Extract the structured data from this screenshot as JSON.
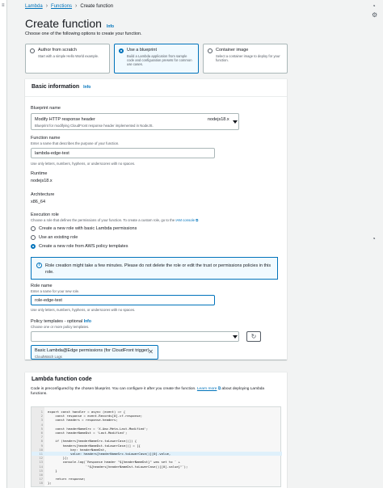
{
  "breadcrumbs": [
    "Lambda",
    "Functions",
    "Create function"
  ],
  "page": {
    "title": "Create function",
    "info_label": "Info",
    "description": "Choose one of the following options to create your function."
  },
  "options": [
    {
      "label": "Author from scratch",
      "desc": "Start with a simple Hello World example.",
      "selected": false
    },
    {
      "label": "Use a blueprint",
      "desc": "Build a Lambda application from sample code and configuration presets for common use cases.",
      "selected": true
    },
    {
      "label": "Container image",
      "desc": "Select a container image to deploy for your function.",
      "selected": false
    }
  ],
  "basic": {
    "heading": "Basic information",
    "info_label": "Info",
    "blueprint_label": "Blueprint name",
    "blueprint_value": "Modify HTTP response header",
    "blueprint_runtime": "nodejs18.x",
    "blueprint_sub": "Blueprint for modifying CloudFront response header implemented in NodeJS.",
    "function_name_label": "Function name",
    "function_name_hint": "Enter a name that describes the purpose of your function.",
    "function_name_value": "lambda-edge-test",
    "function_name_constraint": "Use only letters, numbers, hyphens, or underscores with no spaces.",
    "runtime_label": "Runtime",
    "runtime_value": "nodejs18.x",
    "arch_label": "Architecture",
    "arch_value": "x86_64",
    "exec_role_label": "Execution role",
    "exec_role_desc": "Choose a role that defines the permissions of your function. To create a custom role, go to the",
    "iam_link": "IAM console",
    "role_options": [
      {
        "label": "Create a new role with basic Lambda permissions",
        "selected": false
      },
      {
        "label": "Use an existing role",
        "selected": false
      },
      {
        "label": "Create a new role from AWS policy templates",
        "selected": true
      }
    ],
    "alert_text": "Role creation might take a few minutes. Please do not delete the role or edit the trust or permissions policies in this role.",
    "role_name_label": "Role name",
    "role_name_hint": "Enter a name for your new role.",
    "role_name_value": "role-edge-test",
    "role_name_constraint": "Use only letters, numbers, hyphens, or underscores with no spaces.",
    "policy_label": "Policy templates - optional",
    "policy_info": "Info",
    "policy_hint": "Choose one or more policy templates.",
    "policy_token": "Basic Lambda@Edge permissions (for CloudFront trigger)",
    "policy_token_sub": "CloudWatch Logs"
  },
  "code": {
    "heading": "Lambda function code",
    "desc_before": "Code is preconfigured by the chosen blueprint. You can configure it after you create the function.",
    "learn_more": "Learn more",
    "desc_after": "about deploying Lambda functions.",
    "lines": [
      "export const handler = async (event) => {",
      "    const response = event.Records[0].cf.response;",
      "    const headers = response.headers;",
      "",
      "    const headerNameSrc = 'X-Amz-Meta-Last-Modified';",
      "    const headerNameDst = 'Last-Modified';",
      "",
      "    if (headers[headerNameSrc.toLowerCase()]) {",
      "        headers[headerNameDst.toLowerCase()] = [{",
      "            key: headerNameDst,",
      "            value: headers[headerNameSrc.toLowerCase()][0].value,",
      "        }];",
      "        console.log(`Response header \"${headerNameDst}\" was set to ` +",
      "                    `\"${headers[headerNameDst.toLowerCase()][0].value}\"`);",
      "    }",
      "",
      "    return response;",
      "};"
    ],
    "highlight_line": 11
  }
}
